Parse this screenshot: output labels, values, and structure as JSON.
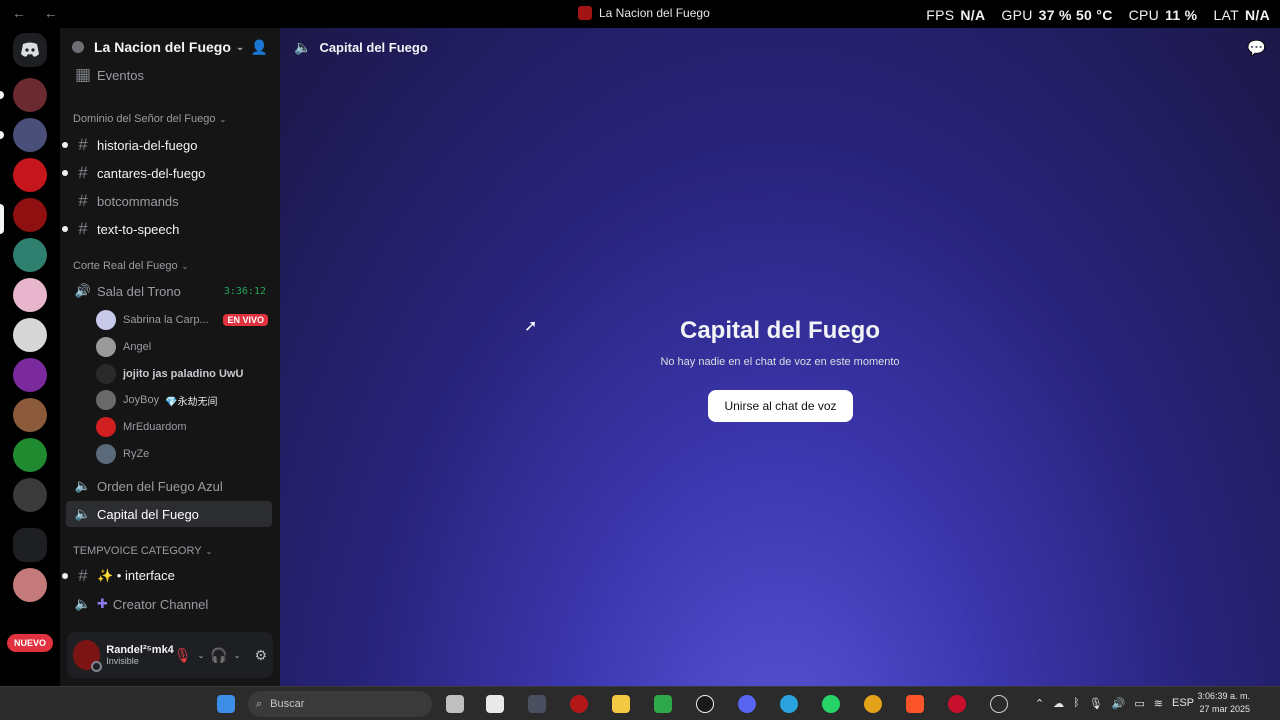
{
  "window": {
    "title": "La Nacion del Fuego",
    "nav_back": "←",
    "nav_forward": "←"
  },
  "overlay": {
    "fps_label": "FPS",
    "fps_value": "N/A",
    "gpu_label": "GPU",
    "gpu_value": "37 %  50 °C",
    "cpu_label": "CPU",
    "cpu_value": "11 %",
    "lat_label": "LAT",
    "lat_value": "N/A"
  },
  "rail": {
    "nuevo_badge": "NUEVO"
  },
  "server": {
    "name": "La Nacion del Fuego"
  },
  "channels": {
    "events": "Eventos",
    "cat1": "Dominio del Señor del Fuego",
    "text1": [
      "historia-del-fuego",
      "cantares-del-fuego",
      "botcommands",
      "text-to-speech"
    ],
    "cat2": "Corte Real del Fuego",
    "voice1": {
      "name": "Sala del Trono",
      "timer": "3:36:12"
    },
    "users": [
      {
        "name": "Sabrina la Carp...",
        "badge": "EN VIVO"
      },
      {
        "name": "Angel"
      },
      {
        "name": "jojito jas paladino UwU"
      },
      {
        "name": "JoyBoy",
        "extra": "💎永劫无间"
      },
      {
        "name": "MrEduardom"
      },
      {
        "name": "RyZe"
      }
    ],
    "voice2": "Orden del Fuego Azul",
    "voice3": "Capital del Fuego",
    "cat3": "TEMPVOICE CATEGORY",
    "text2": "✨ • interface",
    "creator": "Creator Channel"
  },
  "user_panel": {
    "name": "Randel²⁵mk4",
    "status": "Invisible"
  },
  "main": {
    "header_title": "Capital del Fuego",
    "voice_title": "Capital del Fuego",
    "voice_subtitle": "No hay nadie en el chat de voz en este momento",
    "join_label": "Unirse al chat de voz"
  },
  "taskbar": {
    "search_placeholder": "Buscar",
    "lang": "ESP",
    "time": "3:06:39 a. m.",
    "date": "27 mar 2025"
  },
  "colors": {
    "accent_green": "#23a55a",
    "live_red": "#e0333f",
    "sidebar_bg": "#151516"
  }
}
